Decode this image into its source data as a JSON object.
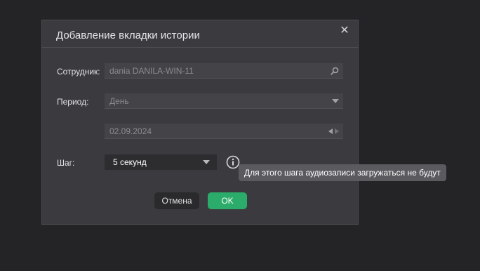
{
  "dialog": {
    "title": "Добавление вкладки истории",
    "close_icon": "close-icon"
  },
  "form": {
    "employee_label": "Сотрудник:",
    "employee_value": "dania DANILA-WIN-11",
    "employee_icon": "search-icon",
    "period_label": "Период:",
    "period_value": "День",
    "period_icon": "chevron-down-icon",
    "date_value": "02.09.2024",
    "date_icons": [
      "arrow-left-icon",
      "arrow-right-icon"
    ],
    "step_label": "Шаг:",
    "step_value": "5 секунд",
    "step_icon": "chevron-down-icon",
    "info_icon": "info-icon"
  },
  "tooltip": {
    "text": "Для этого шага аудиозаписи загружаться не будут"
  },
  "buttons": {
    "cancel_label": "Отмена",
    "ok_label": "OK"
  },
  "colors": {
    "background": "#242426",
    "dialog": "#3b3b3f",
    "ok_button": "#2bac6a",
    "tooltip": "#5a5a5f"
  }
}
